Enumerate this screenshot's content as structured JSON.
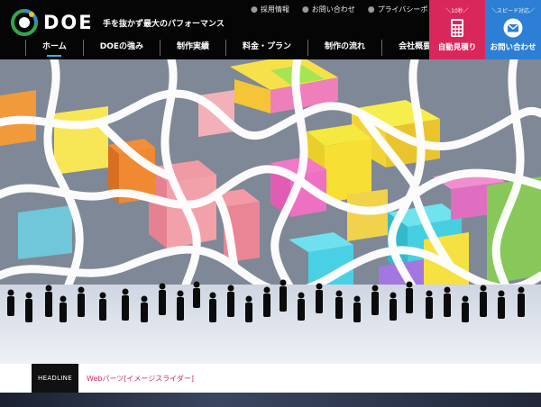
{
  "brand": {
    "logo_text": "DOE",
    "tagline": "手を抜かず最大のパフォーマンス",
    "accent": "#32b6e8"
  },
  "utility_links": [
    {
      "label": "採用情報"
    },
    {
      "label": "お問い合わせ"
    },
    {
      "label": "プライバシーポリシー"
    }
  ],
  "nav": {
    "items": [
      {
        "label": "ホーム",
        "active": true
      },
      {
        "label": "DOEの強み"
      },
      {
        "label": "制作実績"
      },
      {
        "label": "料金・プラン"
      },
      {
        "label": "制作の流れ"
      },
      {
        "label": "会社概要"
      }
    ]
  },
  "cta": {
    "estimate": {
      "sub": "＼10秒／",
      "label": "自動見積り",
      "icon": "calculator-icon",
      "color": "#d9275c"
    },
    "contact": {
      "sub": "＼スピード対応／",
      "label": "お問い合わせ",
      "icon": "envelope-icon",
      "color": "#2d7fd5"
    }
  },
  "headline": {
    "badge": "HEADLINE",
    "text": "Webパーツ[イメージスライダー]"
  }
}
